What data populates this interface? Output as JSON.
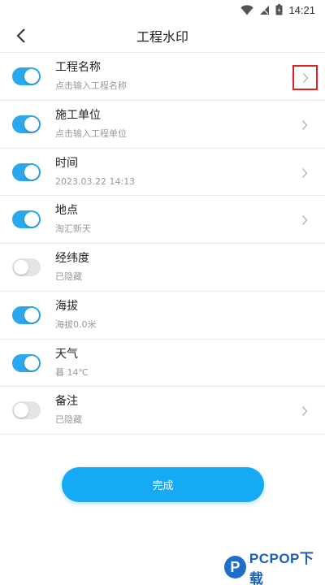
{
  "status": {
    "time": "14:21"
  },
  "header": {
    "title": "工程水印"
  },
  "settings": [
    {
      "title": "工程名称",
      "subtitle": "点击输入工程名称",
      "enabled": true,
      "has_arrow": true,
      "highlighted": true
    },
    {
      "title": "施工单位",
      "subtitle": "点击输入工程单位",
      "enabled": true,
      "has_arrow": true,
      "highlighted": false
    },
    {
      "title": "时间",
      "subtitle": "2023.03.22 14:13",
      "enabled": true,
      "has_arrow": true,
      "highlighted": false
    },
    {
      "title": "地点",
      "subtitle": "淘汇新天",
      "enabled": true,
      "has_arrow": true,
      "highlighted": false
    },
    {
      "title": "经纬度",
      "subtitle": "已隐藏",
      "enabled": false,
      "has_arrow": false,
      "highlighted": false
    },
    {
      "title": "海拔",
      "subtitle": "海拔0.0米",
      "enabled": true,
      "has_arrow": false,
      "highlighted": false
    },
    {
      "title": "天气",
      "subtitle": "暮 14℃",
      "enabled": true,
      "has_arrow": false,
      "highlighted": false
    },
    {
      "title": "备注",
      "subtitle": "已隐藏",
      "enabled": false,
      "has_arrow": true,
      "highlighted": false
    }
  ],
  "done_button": {
    "label": "完成"
  },
  "watermark": {
    "text": "PCPOP下载"
  },
  "colors": {
    "accent": "#2ba7ee",
    "button": "#16a9f4",
    "toggle_off": "#e4e4e4",
    "highlight": "#e02020"
  }
}
